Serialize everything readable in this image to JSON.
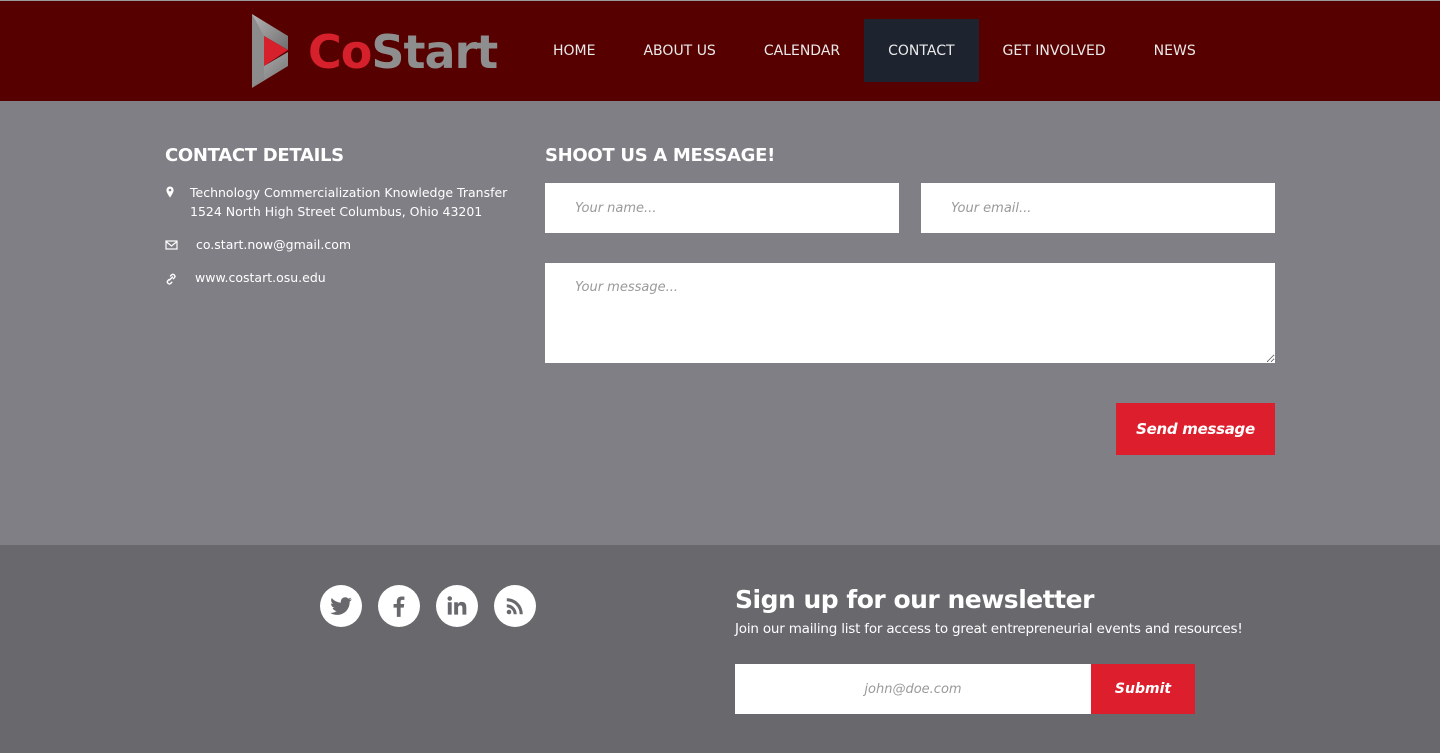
{
  "brand": {
    "part1": "Co",
    "part2": "Start"
  },
  "colors": {
    "header_bg": "#560000",
    "accent": "#dc1e2d",
    "nav_active_bg": "#1e2330",
    "body_bg": "#807f85",
    "footer_bg": "#69686d"
  },
  "nav": {
    "items": [
      {
        "label": "HOME"
      },
      {
        "label": "ABOUT US"
      },
      {
        "label": "CALENDAR"
      },
      {
        "label": "CONTACT",
        "active": true
      },
      {
        "label": "GET INVOLVED"
      },
      {
        "label": "NEWS"
      }
    ]
  },
  "contact": {
    "title": "CONTACT DETAILS",
    "address_line1": "Technology Commercialization Knowledge Transfer",
    "address_line2": "1524 North High Street Columbus, Ohio 43201",
    "email": "co.start.now@gmail.com",
    "website": "www.costart.osu.edu",
    "icons": {
      "address": "map-pin-icon",
      "email": "envelope-icon",
      "website": "link-icon"
    }
  },
  "message_form": {
    "title": "SHOOT US A MESSAGE!",
    "name_placeholder": "Your name...",
    "email_placeholder": "Your email...",
    "message_placeholder": "Your message...",
    "name_value": "",
    "email_value": "",
    "message_value": "",
    "send_label": "Send message"
  },
  "footer": {
    "social": [
      {
        "icon": "twitter-icon"
      },
      {
        "icon": "facebook-icon"
      },
      {
        "icon": "linkedin-icon"
      },
      {
        "icon": "rss-icon"
      }
    ],
    "newsletter": {
      "title": "Sign up for our newsletter",
      "subtitle": "Join our mailing list for access to great entrepreneurial events and resources!",
      "email_placeholder": "john@doe.com",
      "email_value": "",
      "submit_label": "Submit"
    }
  }
}
